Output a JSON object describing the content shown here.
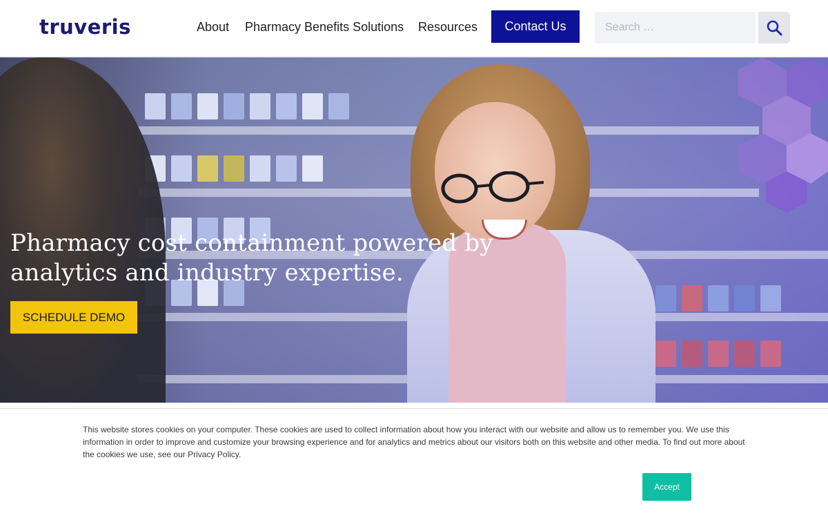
{
  "header": {
    "logo_text": "truveris",
    "nav": [
      {
        "label": "About"
      },
      {
        "label": "Pharmacy Benefits Solutions"
      },
      {
        "label": "Resources"
      }
    ],
    "contact_label": "Contact Us",
    "search": {
      "placeholder": "Search …",
      "value": ""
    }
  },
  "hero": {
    "title": "Pharmacy cost containment powered by analytics and industry expertise.",
    "cta_label": "SCHEDULE DEMO"
  },
  "cookie_banner": {
    "text": "This website stores cookies on your computer. These cookies are used to collect information about how you interact with our website and allow us to remember you. We use this information in order to improve and customize your browsing experience and for analytics and metrics about our visitors both on this website and other media. To find out more about the cookies we use, see our Privacy Policy.",
    "accept_label": "Accept"
  },
  "colors": {
    "brand_navy": "#0e1296",
    "cta_yellow": "#f2c50c",
    "accept_teal": "#0fbfa3"
  },
  "icons": {
    "search": "search-icon",
    "hexagons": "hexagon-pattern-icon"
  }
}
